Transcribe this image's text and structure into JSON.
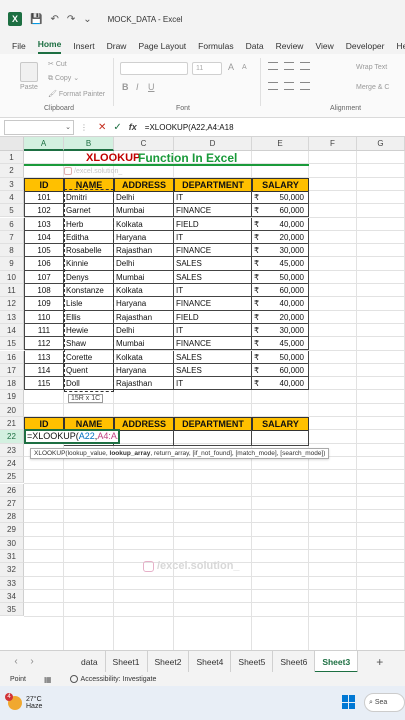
{
  "window": {
    "title": "MOCK_DATA  -  Excel"
  },
  "menu": [
    "File",
    "Home",
    "Insert",
    "Draw",
    "Page Layout",
    "Formulas",
    "Data",
    "Review",
    "View",
    "Developer",
    "Hel"
  ],
  "ribbon": {
    "paste": "Paste",
    "cut": "Cut",
    "copy": "Copy",
    "format_painter": "Format Painter",
    "clipboard": "Clipboard",
    "font_size": "11",
    "font": "Font",
    "wrap_text": "Wrap Text",
    "merge_center": "Merge & C",
    "alignment": "Alignment",
    "bold": "B",
    "italic": "I",
    "underline": "U",
    "grow_font": "A",
    "shrink_font": "A"
  },
  "formula_bar": {
    "fx": "fx",
    "formula": "=XLOOKUP(A22,A4:A18"
  },
  "columns": [
    "A",
    "B",
    "C",
    "D",
    "E",
    "F",
    "G"
  ],
  "rows": [
    "1",
    "2",
    "3",
    "4",
    "5",
    "6",
    "7",
    "8",
    "9",
    "10",
    "11",
    "12",
    "13",
    "14",
    "15",
    "16",
    "17",
    "18",
    "19",
    "20",
    "21",
    "22",
    "23",
    "24",
    "25",
    "26",
    "27",
    "28",
    "29",
    "30",
    "31",
    "32",
    "33",
    "34",
    "35"
  ],
  "title": {
    "xlookup": "XLOOKUP",
    "rest": "Function In Excel"
  },
  "watermark_cell": "/excel.solution_",
  "table1": {
    "headers": [
      "ID",
      "NAME",
      "ADDRESS",
      "DEPARTMENT",
      "SALARY"
    ],
    "rows": [
      [
        "101",
        "Dmitri",
        "Delhi",
        "IT",
        "₹",
        "50,000"
      ],
      [
        "102",
        "Garnet",
        "Mumbai",
        "FINANCE",
        "₹",
        "60,000"
      ],
      [
        "103",
        "Herb",
        "Kolkata",
        "FIELD",
        "₹",
        "40,000"
      ],
      [
        "104",
        "Editha",
        "Haryana",
        "IT",
        "₹",
        "20,000"
      ],
      [
        "105",
        "Rosabelle",
        "Rajasthan",
        "FINANCE",
        "₹",
        "30,000"
      ],
      [
        "106",
        "Kinnie",
        "Delhi",
        "SALES",
        "₹",
        "45,000"
      ],
      [
        "107",
        "Denys",
        "Mumbai",
        "SALES",
        "₹",
        "50,000"
      ],
      [
        "108",
        "Konstanze",
        "Kolkata",
        "IT",
        "₹",
        "60,000"
      ],
      [
        "109",
        "Lisle",
        "Haryana",
        "FINANCE",
        "₹",
        "40,000"
      ],
      [
        "110",
        "Ellis",
        "Rajasthan",
        "FIELD",
        "₹",
        "20,000"
      ],
      [
        "111",
        "Hewie",
        "Delhi",
        "IT",
        "₹",
        "30,000"
      ],
      [
        "112",
        "Shaw",
        "Mumbai",
        "FINANCE",
        "₹",
        "45,000"
      ],
      [
        "113",
        "Corette",
        "Kolkata",
        "SALES",
        "₹",
        "50,000"
      ],
      [
        "114",
        "Quent",
        "Haryana",
        "SALES",
        "₹",
        "60,000"
      ],
      [
        "115",
        "Doll",
        "Rajasthan",
        "IT",
        "₹",
        "40,000"
      ]
    ]
  },
  "size_tip": "15R x 1C",
  "table2": {
    "headers": [
      "ID",
      "NAME",
      "ADDRESS",
      "DEPARTMENT",
      "SALARY"
    ],
    "edit_prefix": "=XLOOKUP(",
    "edit_ref1": "A22",
    "edit_comma": ",",
    "edit_ref2": "A4:A18"
  },
  "tooltip": {
    "fn": "XLOOKUP(lookup_value, ",
    "bold_arg": "lookup_array",
    "rest": ", return_array, [if_not_found], [match_mode], [search_mode])"
  },
  "watermark": "/excel.solution_",
  "sheets": [
    "data",
    "Sheet1",
    "Sheet2",
    "Sheet4",
    "Sheet5",
    "Sheet6",
    "Sheet3"
  ],
  "add_sheet": "+",
  "status": {
    "mode": "Point",
    "accessibility": "Accessibility: Investigate"
  },
  "taskbar": {
    "temp": "27°C",
    "cond": "Haze",
    "badge": "4",
    "search": "Sea"
  }
}
